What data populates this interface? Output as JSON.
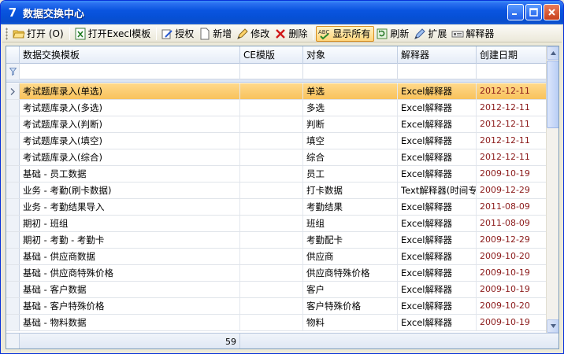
{
  "window": {
    "title": "数据交换中心",
    "app_icon_glyph": "7"
  },
  "toolbar": {
    "buttons": [
      {
        "label": "打开 (O)",
        "icon": "open-folder-icon"
      },
      {
        "label": "打开Execl模板",
        "icon": "excel-icon"
      },
      {
        "label": "授权",
        "icon": "authorize-icon"
      },
      {
        "label": "新增",
        "icon": "new-document-icon"
      },
      {
        "label": "修改",
        "icon": "edit-icon"
      },
      {
        "label": "删除",
        "icon": "delete-x-icon"
      },
      {
        "label": "显示所有",
        "icon": "show-all-icon"
      },
      {
        "label": "刷新",
        "icon": "refresh-icon"
      },
      {
        "label": "扩展",
        "icon": "extend-icon"
      },
      {
        "label": "解释器",
        "icon": "interpreter-icon"
      }
    ]
  },
  "grid": {
    "columns": [
      "数据交换模板",
      "CE模版",
      "对象",
      "解释器",
      "创建日期"
    ],
    "rows": [
      {
        "template": "考试题库录入(单选)",
        "ce": "",
        "object": "单选",
        "interpreter": "Excel解释器",
        "date": "2012-12-11"
      },
      {
        "template": "考试题库录入(多选)",
        "ce": "",
        "object": "多选",
        "interpreter": "Excel解释器",
        "date": "2012-12-11"
      },
      {
        "template": "考试题库录入(判断)",
        "ce": "",
        "object": "判断",
        "interpreter": "Excel解释器",
        "date": "2012-12-11"
      },
      {
        "template": "考试题库录入(填空)",
        "ce": "",
        "object": "填空",
        "interpreter": "Excel解释器",
        "date": "2012-12-11"
      },
      {
        "template": "考试题库录入(综合)",
        "ce": "",
        "object": "综合",
        "interpreter": "Excel解释器",
        "date": "2012-12-11"
      },
      {
        "template": "基础 - 员工数据",
        "ce": "",
        "object": "员工",
        "interpreter": "Excel解释器",
        "date": "2009-10-19"
      },
      {
        "template": "业务 - 考勤(刷卡数据)",
        "ce": "",
        "object": "打卡数据",
        "interpreter": "Text解释器(时间专",
        "date": "2009-12-29"
      },
      {
        "template": "业务 - 考勤结果导入",
        "ce": "",
        "object": "考勤结果",
        "interpreter": "Excel解释器",
        "date": "2011-08-09"
      },
      {
        "template": "期初 - 班组",
        "ce": "",
        "object": "班组",
        "interpreter": "Excel解释器",
        "date": "2011-08-09"
      },
      {
        "template": "期初 - 考勤 - 考勤卡",
        "ce": "",
        "object": "考勤配卡",
        "interpreter": "Excel解释器",
        "date": "2009-12-29"
      },
      {
        "template": "基础 - 供应商数据",
        "ce": "",
        "object": "供应商",
        "interpreter": "Excel解释器",
        "date": "2009-10-20"
      },
      {
        "template": "基础 - 供应商特殊价格",
        "ce": "",
        "object": "供应商特殊价格",
        "interpreter": "Excel解释器",
        "date": "2009-10-19"
      },
      {
        "template": "基础 - 客户数据",
        "ce": "",
        "object": "客户",
        "interpreter": "Excel解释器",
        "date": "2009-10-19"
      },
      {
        "template": "基础 - 客户特殊价格",
        "ce": "",
        "object": "客户特殊价格",
        "interpreter": "Excel解释器",
        "date": "2009-10-20"
      },
      {
        "template": "基础 - 物料数据",
        "ce": "",
        "object": "物料",
        "interpreter": "Excel解释器",
        "date": "2009-10-19"
      }
    ],
    "selected_index": 0,
    "footer_count": "59"
  },
  "colors": {
    "selected_row": "#f8c25c",
    "date_text": "#8b1a1a",
    "title_bar": "#0a55e0"
  }
}
